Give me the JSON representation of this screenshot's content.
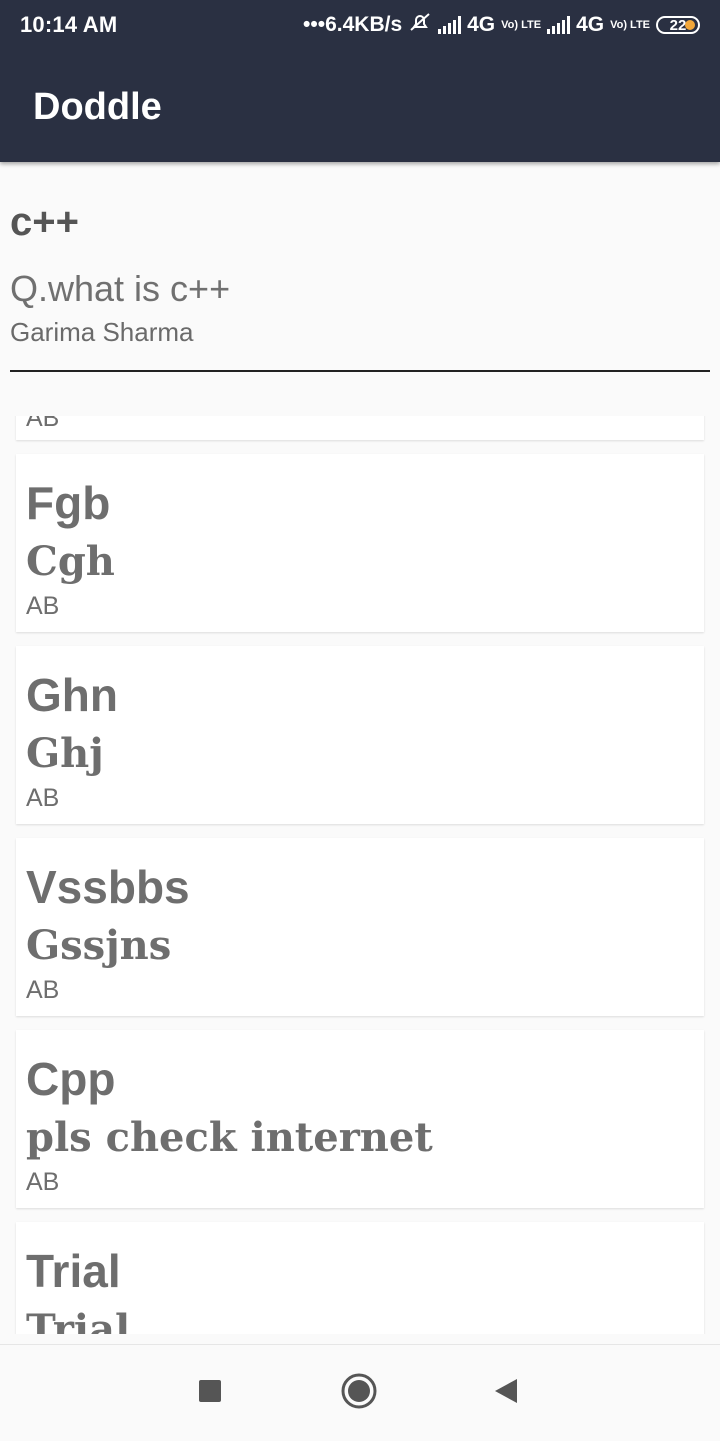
{
  "status_bar": {
    "time": "10:14 AM",
    "network_speed": "•••6.4KB/s",
    "network_type_1": "4G",
    "network_type_2": "4G",
    "volte_label": "Vo) LTE",
    "battery": "22"
  },
  "app_bar": {
    "title": "Doddle"
  },
  "question": {
    "topic": "c++",
    "text": "Q.what is c++",
    "author": "Garima Sharma"
  },
  "answers": [
    {
      "title": "",
      "body": "",
      "author": "AB"
    },
    {
      "title": "Fgb",
      "body": "Cgh",
      "author": "AB"
    },
    {
      "title": "Ghn",
      "body": "Ghj",
      "author": "AB"
    },
    {
      "title": "Vssbbs",
      "body": "Gssjns",
      "author": "AB"
    },
    {
      "title": "Cpp",
      "body": "pls check internet",
      "author": "AB"
    },
    {
      "title": "Trial",
      "body": "Trial",
      "author": ""
    }
  ],
  "nav": {
    "recents": "stop-square-icon",
    "home": "home-circle-icon",
    "back": "back-triangle-icon"
  }
}
